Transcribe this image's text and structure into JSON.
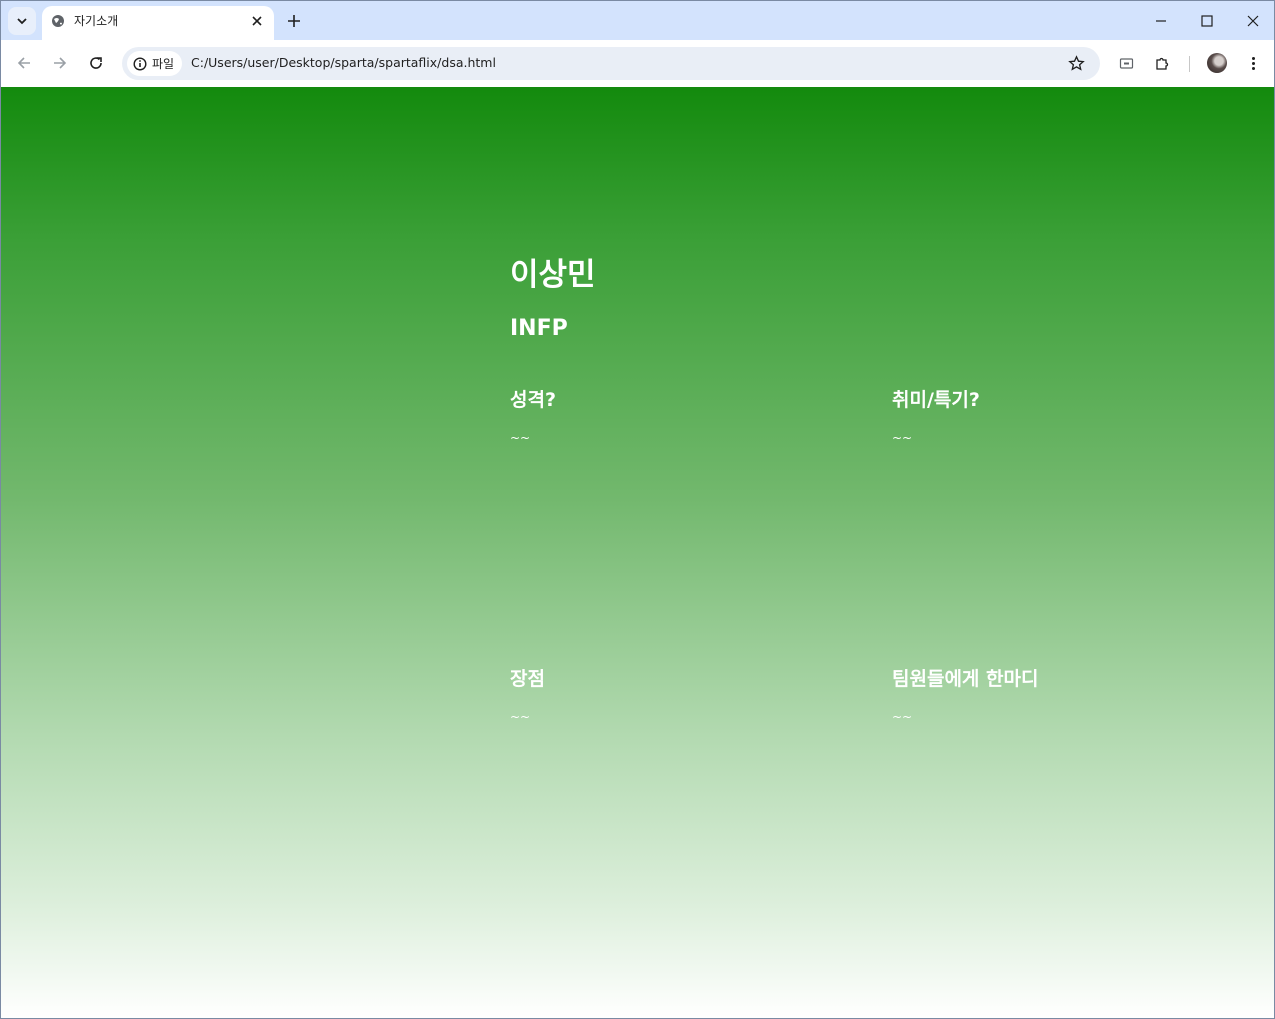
{
  "browser": {
    "tab_title": "자기소개",
    "site_chip_label": "파일",
    "url": "C:/Users/user/Desktop/sparta/spartaflix/dsa.html"
  },
  "page": {
    "name": "이상민",
    "mbti": "INFP",
    "sections": [
      {
        "title": "성격?",
        "body": "~~"
      },
      {
        "title": "취미/특기?",
        "body": "~~"
      },
      {
        "title": "장점",
        "body": "~~"
      },
      {
        "title": "팀원들에게 한마디",
        "body": "~~"
      }
    ]
  },
  "colors": {
    "gradient_top": "#138a0d",
    "gradient_bottom": "#ffffff",
    "tabstrip": "#d3e3fd"
  }
}
